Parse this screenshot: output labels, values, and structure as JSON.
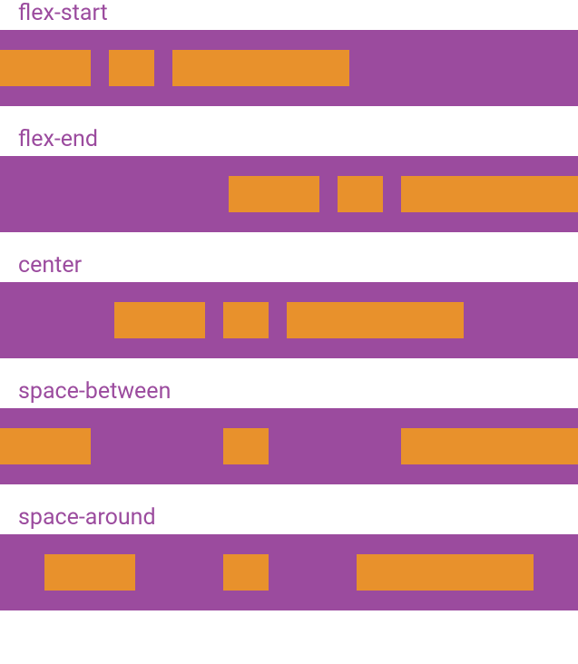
{
  "examples": [
    {
      "id": "flex-start",
      "label": "flex-start",
      "justify": "flex-start",
      "items": [
        "medium",
        "small",
        "large"
      ]
    },
    {
      "id": "flex-end",
      "label": "flex-end",
      "justify": "flex-end",
      "items": [
        "medium",
        "small",
        "large"
      ]
    },
    {
      "id": "center",
      "label": "center",
      "justify": "center",
      "items": [
        "medium",
        "small",
        "large"
      ]
    },
    {
      "id": "space-between",
      "label": "space-between",
      "justify": "space-between",
      "items": [
        "medium",
        "small",
        "large"
      ]
    },
    {
      "id": "space-around",
      "label": "space-around",
      "justify": "space-around",
      "items": [
        "medium",
        "small",
        "large"
      ]
    }
  ],
  "colors": {
    "container": "#9b4b9e",
    "item": "#e8912c",
    "label": "#9b4b9e"
  }
}
